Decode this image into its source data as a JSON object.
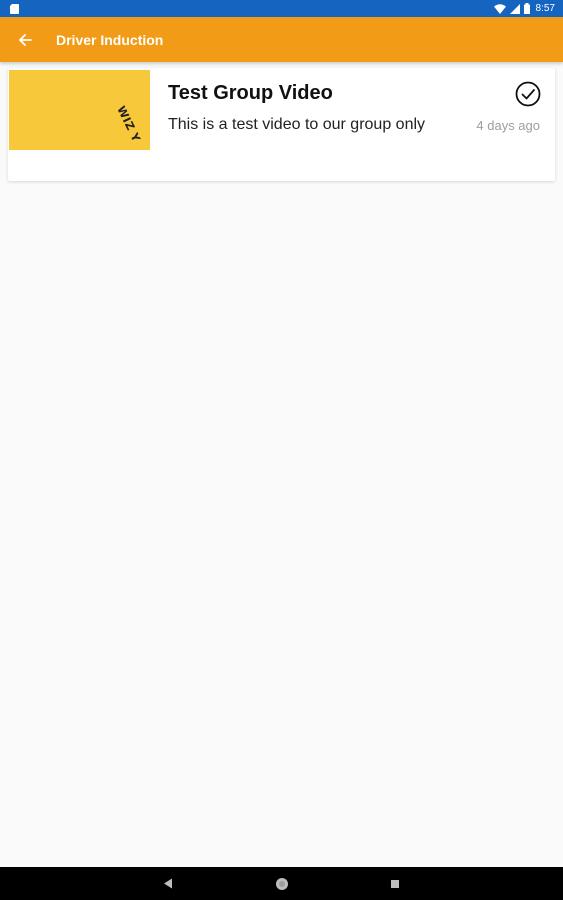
{
  "status_bar": {
    "time": "8:57",
    "icons": [
      "sd-card-icon",
      "wifi-icon",
      "signal-icon",
      "battery-icon"
    ],
    "color": "#1565c0"
  },
  "app_bar": {
    "title": "Driver Induction",
    "back_icon": "arrow-back-icon",
    "color": "#f29b16"
  },
  "videos": [
    {
      "title": "Test Group Video",
      "description": "This is a test video to our group only",
      "time_ago": "4 days ago",
      "completed_icon": "check-circle-icon",
      "thumbnail_color": "#f7c83a",
      "thumbnail_text": "WIZ Y"
    }
  ],
  "nav_bar": {
    "icons": [
      "nav-back-icon",
      "nav-home-icon",
      "nav-recents-icon"
    ]
  }
}
